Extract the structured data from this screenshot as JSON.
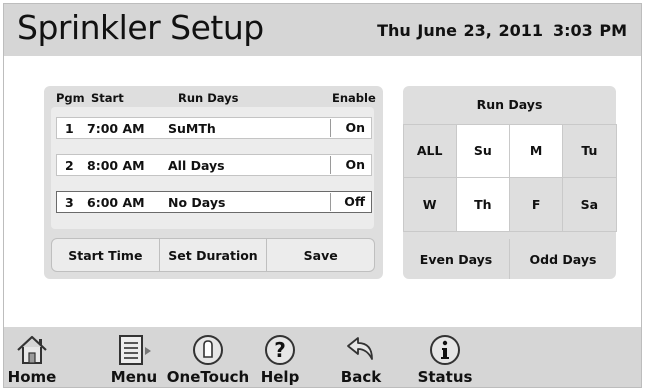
{
  "header": {
    "title": "Sprinkler Setup",
    "date": "Thu June 23, 2011",
    "time": "3:03 PM"
  },
  "programs": {
    "headers": {
      "pgm": "Pgm",
      "start": "Start",
      "run_days": "Run Days",
      "enable": "Enable"
    },
    "rows": [
      {
        "pgm": "1",
        "start": "7:00 AM",
        "days": "SuMTh",
        "enable": "On"
      },
      {
        "pgm": "2",
        "start": "8:00 AM",
        "days": "All Days",
        "enable": "On"
      },
      {
        "pgm": "3",
        "start": "6:00 AM",
        "days": "No Days",
        "enable": "Off"
      }
    ],
    "buttons": {
      "start_time": "Start Time",
      "set_duration": "Set Duration",
      "save": "Save"
    }
  },
  "run_days": {
    "title": "Run Days",
    "grid": [
      {
        "label": "ALL",
        "selected": false
      },
      {
        "label": "Su",
        "selected": true
      },
      {
        "label": "M",
        "selected": true
      },
      {
        "label": "Tu",
        "selected": false
      },
      {
        "label": "W",
        "selected": false
      },
      {
        "label": "Th",
        "selected": true
      },
      {
        "label": "F",
        "selected": false
      },
      {
        "label": "Sa",
        "selected": false
      }
    ],
    "even_days": "Even Days",
    "odd_days": "Odd Days"
  },
  "nav": {
    "home": "Home",
    "menu": "Menu",
    "onetouch": "OneTouch",
    "help": "Help",
    "back": "Back",
    "status": "Status"
  },
  "colors": {
    "bar_background": "#d6d6d6",
    "panel_background": "#dedede",
    "selected_day": "#ffffff"
  }
}
